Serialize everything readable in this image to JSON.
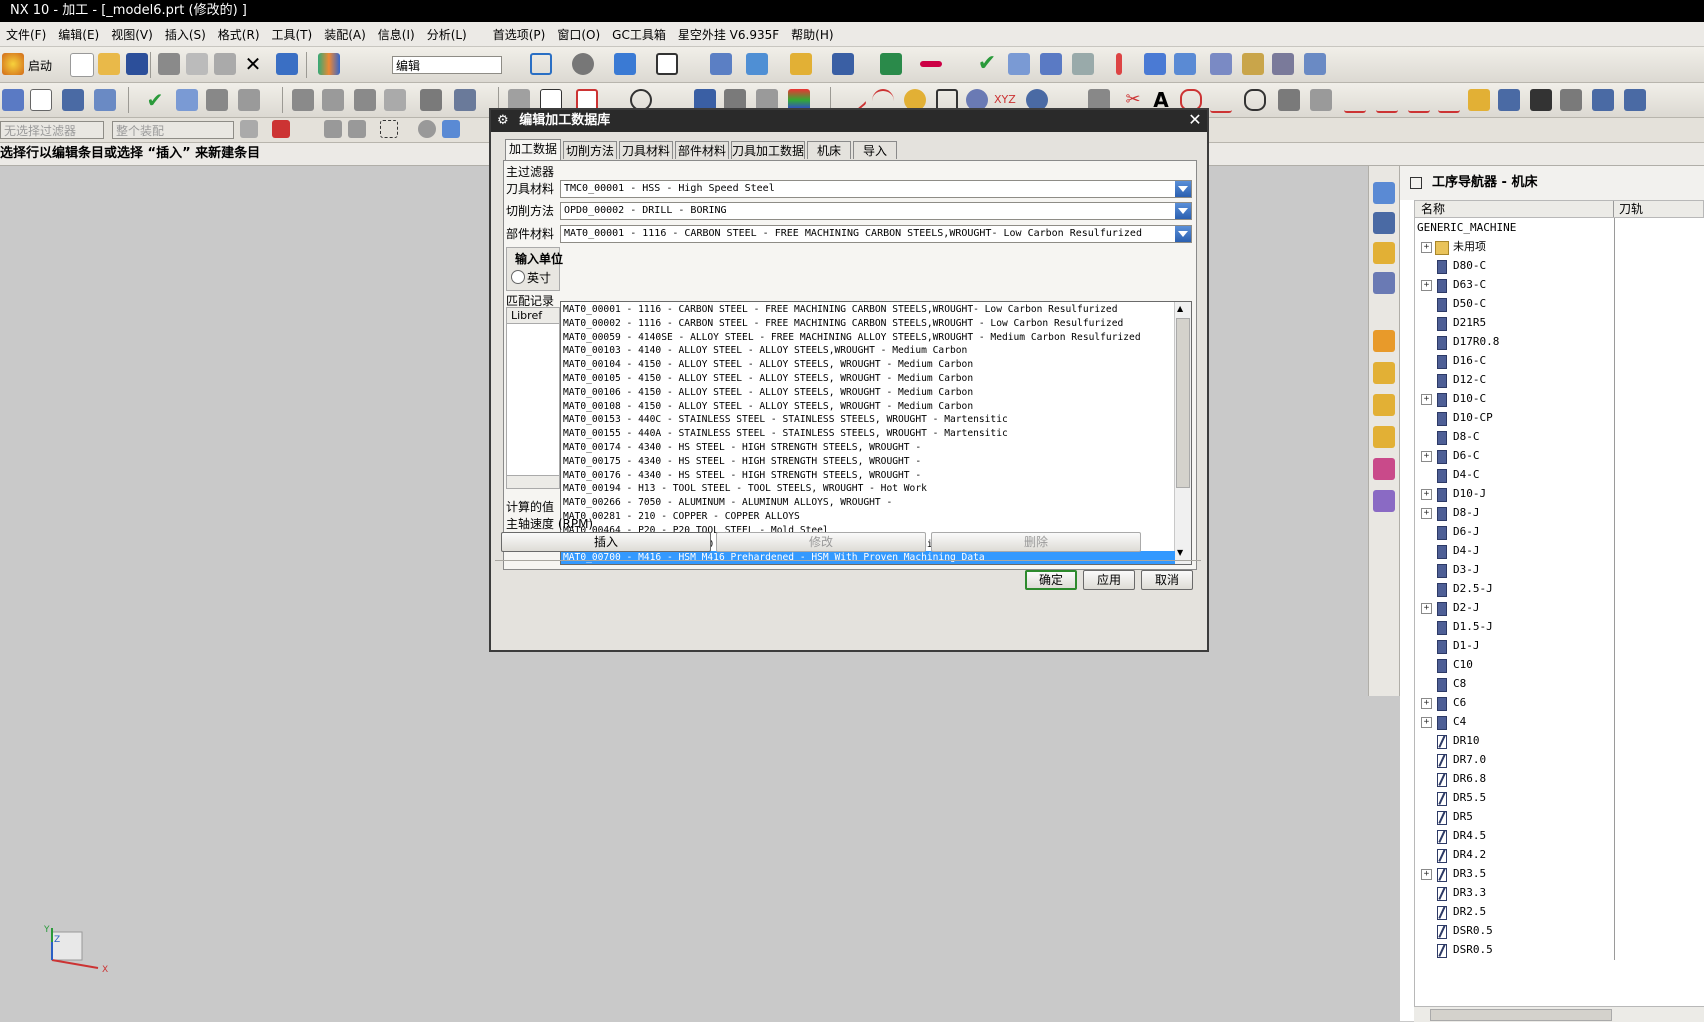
{
  "window": {
    "title": "NX 10 - 加工 - [_model6.prt  (修改的) ]"
  },
  "menu": [
    "文件(F)",
    "编辑(E)",
    "视图(V)",
    "插入(S)",
    "格式(R)",
    "工具(T)",
    "装配(A)",
    "信息(I)",
    "分析(L)",
    "首选项(P)",
    "窗口(O)",
    "GC工具箱",
    "星空外挂 V6.935F",
    "帮助(H)"
  ],
  "toolbar": {
    "start_label": "启动",
    "edit_combo": "编辑",
    "filter_combo": "无选择过滤器",
    "assembly_combo": "整个装配"
  },
  "status": {
    "prompt": "选择行以编辑条目或选择 “插入” 来新建条目"
  },
  "dialog": {
    "title": "编辑加工数据库",
    "tabs": [
      "加工数据",
      "切削方法",
      "刀具材料",
      "部件材料",
      "刀具加工数据",
      "机床",
      "导入"
    ],
    "active_tab": "加工数据",
    "main_filter_label": "主过滤器",
    "tool_material_label": "刀具材料",
    "tool_material_value": "TMC0_00001 - HSS - High Speed Steel",
    "cut_method_label": "切削方法",
    "cut_method_value": "OPD0_00002 - DRILL - BORING",
    "part_material_label": "部件材料",
    "part_material_value": "MAT0_00001 - 1116 - CARBON STEEL - FREE MACHINING CARBON STEELS,WROUGHT- Low Carbon Resulfurized",
    "input_unit_label": "输入单位",
    "inch_label": "英寸",
    "match_label": "匹配记录",
    "libref_header": "Libref",
    "computed_label": "计算的值",
    "spindle_label": "主轴速度 (RPM)",
    "options": [
      "MAT0_00001 - 1116 - CARBON STEEL - FREE MACHINING CARBON STEELS,WROUGHT- Low Carbon Resulfurized",
      "MAT0_00002 - 1116 - CARBON STEEL - FREE MACHINING CARBON STEELS,WROUGHT - Low Carbon Resulfurized",
      "MAT0_00059 - 4140SE - ALLOY STEEL - FREE MACHINING ALLOY STEELS,WROUGHT - Medium Carbon Resulfurized",
      "MAT0_00103 - 4140 - ALLOY STEEL - ALLOY STEELS,WROUGHT - Medium Carbon",
      "MAT0_00104 - 4150 - ALLOY STEEL - ALLOY STEELS, WROUGHT - Medium Carbon",
      "MAT0_00105 - 4150 - ALLOY STEEL - ALLOY STEELS, WROUGHT - Medium Carbon",
      "MAT0_00106 - 4150 - ALLOY STEEL - ALLOY STEELS, WROUGHT - Medium Carbon",
      "MAT0_00108 - 4150 - ALLOY STEEL - ALLOY STEELS, WROUGHT - Medium Carbon",
      "MAT0_00153 - 440C - STAINLESS STEEL - STAINLESS STEELS, WROUGHT - Martensitic",
      "MAT0_00155 - 440A - STAINLESS STEEL - STAINLESS STEELS, WROUGHT - Martensitic",
      "MAT0_00174 - 4340 - HS STEEL - HIGH STRENGTH STEELS, WROUGHT -",
      "MAT0_00175 - 4340 - HS STEEL - HIGH STRENGTH STEELS, WROUGHT -",
      "MAT0_00176 - 4340 - HS STEEL - HIGH STRENGTH STEELS, WROUGHT -",
      "MAT0_00194 - H13 - TOOL STEEL - TOOL STEELS, WROUGHT - Hot Work",
      "MAT0_00266 - 7050 - ALUMINUM - ALUMINUM ALLOYS, WROUGHT -",
      "MAT0_00281 - 210 - COPPER - COPPER ALLOYS",
      "MAT0_00464 - P20 - P20 TOOL STEEL - Mold Steel",
      "MAT0_00600 - P20 - HSM P20 Prehardened - HSM With Proven Machining Data",
      "MAT0_00700 - M416 - HSM M416 Prehardened - HSM With Proven Machining Data"
    ],
    "selected_option": "MAT0_00700 - M416 - HSM M416 Prehardened - HSM With Proven Machining Data",
    "insert_label": "插入",
    "modify_label": "修改",
    "delete_label": "删除",
    "ok_label": "确定",
    "apply_label": "应用",
    "cancel_label": "取消"
  },
  "navigator": {
    "title": "工序导航器 - 机床",
    "col_name": "名称",
    "col_path": "刀轨",
    "root": "GENERIC_MACHINE",
    "unused": "未用项",
    "items": [
      {
        "label": "D80-C",
        "expandable": false,
        "kind": "mill"
      },
      {
        "label": "D63-C",
        "expandable": true,
        "kind": "mill"
      },
      {
        "label": "D50-C",
        "expandable": false,
        "kind": "mill"
      },
      {
        "label": "D21R5",
        "expandable": false,
        "kind": "mill"
      },
      {
        "label": "D17R0.8",
        "expandable": false,
        "kind": "mill"
      },
      {
        "label": "D16-C",
        "expandable": false,
        "kind": "mill"
      },
      {
        "label": "D12-C",
        "expandable": false,
        "kind": "mill"
      },
      {
        "label": "D10-C",
        "expandable": true,
        "kind": "mill"
      },
      {
        "label": "D10-CP",
        "expandable": false,
        "kind": "mill"
      },
      {
        "label": "D8-C",
        "expandable": false,
        "kind": "mill"
      },
      {
        "label": "D6-C",
        "expandable": true,
        "kind": "mill"
      },
      {
        "label": "D4-C",
        "expandable": false,
        "kind": "mill"
      },
      {
        "label": "D10-J",
        "expandable": true,
        "kind": "mill"
      },
      {
        "label": "D8-J",
        "expandable": true,
        "kind": "mill"
      },
      {
        "label": "D6-J",
        "expandable": false,
        "kind": "mill"
      },
      {
        "label": "D4-J",
        "expandable": false,
        "kind": "mill"
      },
      {
        "label": "D3-J",
        "expandable": false,
        "kind": "mill"
      },
      {
        "label": "D2.5-J",
        "expandable": false,
        "kind": "mill"
      },
      {
        "label": "D2-J",
        "expandable": true,
        "kind": "mill"
      },
      {
        "label": "D1.5-J",
        "expandable": false,
        "kind": "mill"
      },
      {
        "label": "D1-J",
        "expandable": false,
        "kind": "mill"
      },
      {
        "label": "C10",
        "expandable": false,
        "kind": "mill"
      },
      {
        "label": "C8",
        "expandable": false,
        "kind": "mill"
      },
      {
        "label": "C6",
        "expandable": true,
        "kind": "mill"
      },
      {
        "label": "C4",
        "expandable": true,
        "kind": "mill"
      },
      {
        "label": "DR10",
        "expandable": false,
        "kind": "drill"
      },
      {
        "label": "DR7.0",
        "expandable": false,
        "kind": "drill"
      },
      {
        "label": "DR6.8",
        "expandable": false,
        "kind": "drill"
      },
      {
        "label": "DR5.5",
        "expandable": false,
        "kind": "drill"
      },
      {
        "label": "DR5",
        "expandable": false,
        "kind": "drill"
      },
      {
        "label": "DR4.5",
        "expandable": false,
        "kind": "drill"
      },
      {
        "label": "DR4.2",
        "expandable": false,
        "kind": "drill"
      },
      {
        "label": "DR3.5",
        "expandable": true,
        "kind": "drill"
      },
      {
        "label": "DR3.3",
        "expandable": false,
        "kind": "drill"
      },
      {
        "label": "DR2.5",
        "expandable": false,
        "kind": "drill"
      },
      {
        "label": "DSR0.5",
        "expandable": false,
        "kind": "drill"
      },
      {
        "label": "DSR0.5",
        "expandable": false,
        "kind": "drill"
      }
    ]
  },
  "triad": {
    "x": "X",
    "y": "Y",
    "z": "Z"
  },
  "colors": {
    "selection": "#3399ff",
    "tool_icon": "#4e5f96",
    "title_bg": "#000000"
  }
}
